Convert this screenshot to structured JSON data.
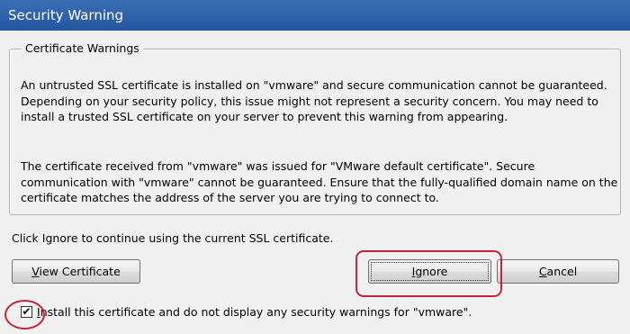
{
  "window": {
    "title": "Security Warning"
  },
  "group": {
    "legend": "Certificate Warnings",
    "paragraph1": "An untrusted SSL certificate is installed on \"vmware\" and secure communication cannot be guaranteed.  Depending on your security policy, this issue might not represent a security concern.  You may need to install a trusted SSL certificate on your server to prevent this warning from appearing.",
    "paragraph2": "The certificate received from \"vmware\" was issued for \"VMware default certificate\".  Secure communication with \"vmware\" cannot be guaranteed.  Ensure that the fully-qualified domain name on the certificate matches the address of the server you are trying to connect to."
  },
  "info_text": "Click Ignore to continue using the current SSL certificate.",
  "buttons": {
    "view_certificate": {
      "accel": "V",
      "rest": "iew Certificate"
    },
    "ignore": {
      "accel": "I",
      "rest": "gnore"
    },
    "cancel": {
      "accel": "C",
      "rest": "ancel"
    }
  },
  "checkbox": {
    "checked": true,
    "mark": "✔",
    "accel": "I",
    "rest": "nstall this certificate and do not display any security warnings for \"vmware\"."
  },
  "colors": {
    "titlebar": "#2b5fa4",
    "annotation": "#c0283a"
  }
}
